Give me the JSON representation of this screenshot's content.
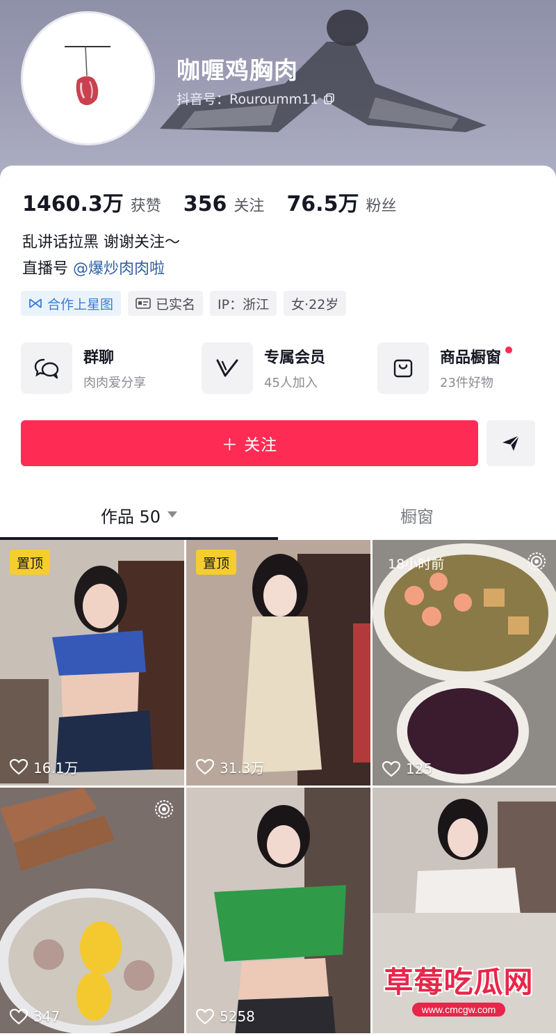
{
  "profile": {
    "nickname": "咖喱鸡胸肉",
    "douyin_id": "抖音号：Rouroumm11",
    "avatar": "meat-hook-avatar"
  },
  "stats": [
    {
      "value": "1460.3万",
      "label": "获赞"
    },
    {
      "value": "356",
      "label": "关注"
    },
    {
      "value": "76.5万",
      "label": "粉丝"
    }
  ],
  "bio": {
    "line1": "乱讲话拉黑 谢谢关注～",
    "line2_prefix": "直播号 ",
    "line2_link": "@爆炒肉肉啦"
  },
  "tags": {
    "star": "合作上星图",
    "verified": "已实名",
    "ip": "IP：浙江",
    "gender_age": "女·22岁"
  },
  "services": [
    {
      "title": "群聊",
      "subtitle": "肉肉爱分享",
      "icon": "chat-bubbles-icon"
    },
    {
      "title": "专属会员",
      "subtitle": "45人加入",
      "icon": "v-badge-icon"
    },
    {
      "title": "商品橱窗",
      "subtitle": "23件好物",
      "icon": "shopping-bag-icon"
    }
  ],
  "follow_button": "＋ 关注",
  "tabs": {
    "works": "作品 50",
    "showcase": "橱窗"
  },
  "videos": [
    {
      "pin": "置顶",
      "likes": "16.1万"
    },
    {
      "pin": "置顶",
      "likes": "31.3万"
    },
    {
      "time": "18小时前",
      "likes": "125",
      "live": true
    },
    {
      "likes": "347",
      "live": true
    },
    {
      "likes": "5258"
    },
    {
      "likes": ""
    }
  ],
  "watermark": {
    "title": "草莓吃瓜网",
    "url": "www.cmcgw.com"
  },
  "colors": {
    "accent": "#fe2c55",
    "pin": "#f6cd2e",
    "link": "#2f5c9e"
  }
}
